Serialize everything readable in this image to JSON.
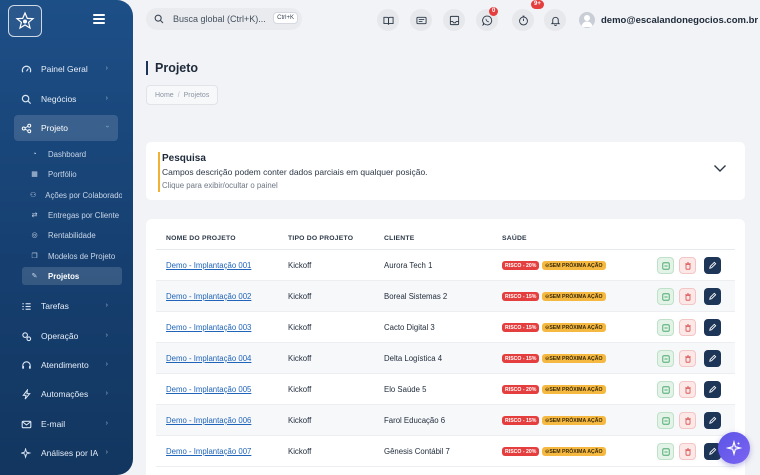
{
  "topbar": {
    "search_placeholder": "Busca global (Ctrl+K)...",
    "search_shortcut": "Ctrl+K",
    "whatsapp_badge": "0",
    "tasks_badge": "9+",
    "user_email": "demo@escalandonegocios.com.br"
  },
  "sidebar": {
    "items": [
      {
        "label": "Painel Geral",
        "icon": "gauge-icon"
      },
      {
        "label": "Negócios",
        "icon": "search-icon"
      },
      {
        "label": "Projeto",
        "icon": "share-nodes-icon"
      },
      {
        "label": "Tarefas",
        "icon": "list-check-icon"
      },
      {
        "label": "Operação",
        "icon": "gears-icon"
      },
      {
        "label": "Atendimento",
        "icon": "headset-icon"
      },
      {
        "label": "Automações",
        "icon": "bolt-icon"
      },
      {
        "label": "E-mail",
        "icon": "envelope-icon"
      },
      {
        "label": "Análises por IA",
        "icon": "sparkles-icon"
      }
    ],
    "projeto_subitems": [
      {
        "label": "Dashboard"
      },
      {
        "label": "Portfólio"
      },
      {
        "label": "Ações por Colaborador"
      },
      {
        "label": "Entregas por Cliente"
      },
      {
        "label": "Rentabilidade"
      },
      {
        "label": "Modelos de Projeto"
      },
      {
        "label": "Projetos"
      }
    ]
  },
  "page": {
    "title": "Projeto",
    "breadcrumb": [
      "Home",
      "Projetos"
    ]
  },
  "search_panel": {
    "title": "Pesquisa",
    "description": "Campos descrição podem conter dados parciais em qualquer posição.",
    "hint": "Clique para exibir/ocultar o painel"
  },
  "table": {
    "columns": [
      "NOME DO PROJETO",
      "TIPO DO PROJETO",
      "CLIENTE",
      "SAÚDE"
    ],
    "rows": [
      {
        "name": "Demo - Implantação 001",
        "type": "Kickoff",
        "client": "Aurora Tech 1",
        "risk": "RISCO - 20%",
        "action": "⊙SEM PRÓXIMA AÇÃO"
      },
      {
        "name": "Demo - Implantação 002",
        "type": "Kickoff",
        "client": "Boreal Sistemas 2",
        "risk": "RISCO - 15%",
        "action": "⊙SEM PRÓXIMA AÇÃO"
      },
      {
        "name": "Demo - Implantação 003",
        "type": "Kickoff",
        "client": "Cacto Digital 3",
        "risk": "RISCO - 15%",
        "action": "⊙SEM PRÓXIMA AÇÃO"
      },
      {
        "name": "Demo - Implantação 004",
        "type": "Kickoff",
        "client": "Delta Logística 4",
        "risk": "RISCO - 15%",
        "action": "⊙SEM PRÓXIMA AÇÃO"
      },
      {
        "name": "Demo - Implantação 005",
        "type": "Kickoff",
        "client": "Elo Saúde 5",
        "risk": "RISCO - 20%",
        "action": "⊙SEM PRÓXIMA AÇÃO"
      },
      {
        "name": "Demo - Implantação 006",
        "type": "Kickoff",
        "client": "Farol Educação 6",
        "risk": "RISCO - 15%",
        "action": "⊙SEM PRÓXIMA AÇÃO"
      },
      {
        "name": "Demo - Implantação 007",
        "type": "Kickoff",
        "client": "Gênesis Contábil 7",
        "risk": "RISCO - 20%",
        "action": "⊙SEM PRÓXIMA AÇÃO"
      }
    ]
  },
  "colors": {
    "sidebar_bg": "#1d4f87",
    "accent_dark": "#1d3557",
    "risk_red": "#e53e3e",
    "action_yellow": "#f5b942",
    "panel_accent": "#f2b134",
    "fab": "#6a5cec"
  }
}
